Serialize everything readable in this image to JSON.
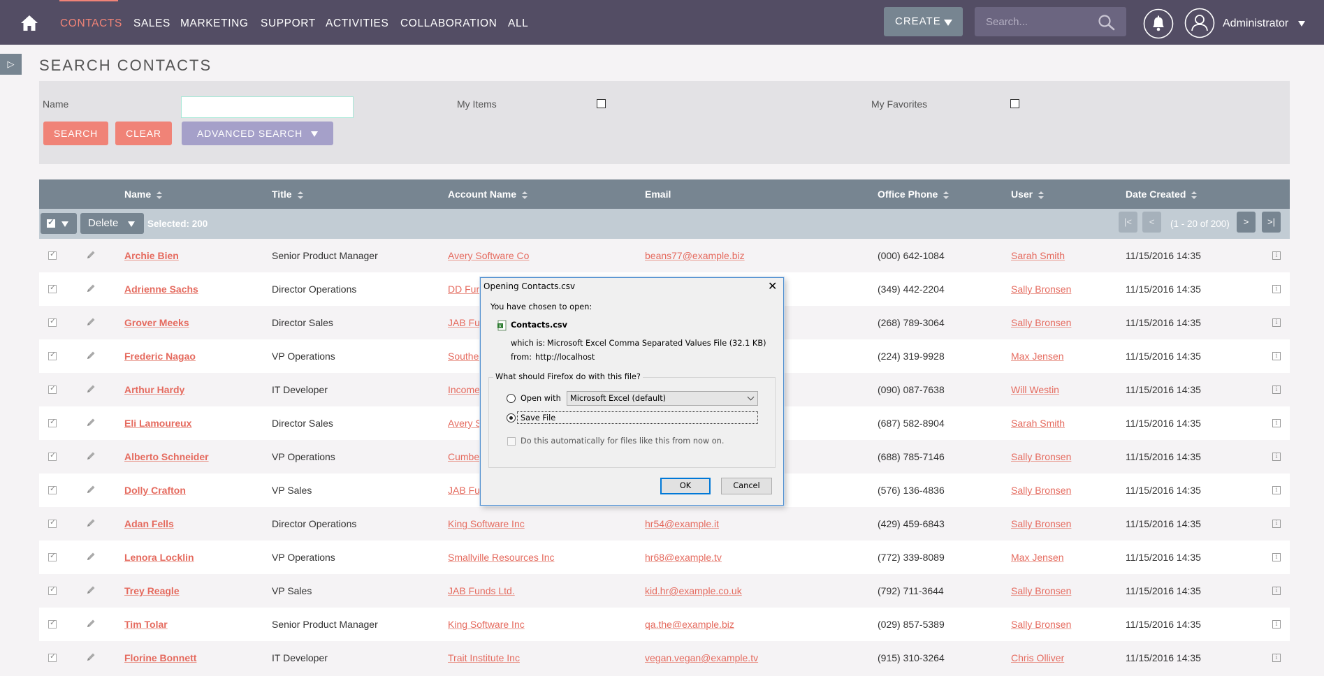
{
  "nav": {
    "items": [
      "CONTACTS",
      "SALES",
      "MARKETING",
      "SUPPORT",
      "ACTIVITIES",
      "COLLABORATION",
      "ALL"
    ],
    "create_label": "CREATE",
    "search_placeholder": "Search...",
    "user_name": "Administrator"
  },
  "page_title": "SEARCH CONTACTS",
  "search_form": {
    "name_label": "Name",
    "my_items_label": "My Items",
    "my_favorites_label": "My Favorites",
    "search_btn": "SEARCH",
    "clear_btn": "CLEAR",
    "advanced_btn": "ADVANCED SEARCH"
  },
  "table": {
    "columns": [
      "Name",
      "Title",
      "Account Name",
      "Email",
      "Office Phone",
      "User",
      "Date Created"
    ],
    "delete_label": "Delete",
    "selected_text": "Selected: 200",
    "pagination_text": "(1 - 20 of 200)",
    "rows": [
      {
        "name": "Archie Bien",
        "title": "Senior Product Manager",
        "account": "Avery Software Co",
        "email": "beans77@example.biz",
        "phone": "(000) 642-1084",
        "user": "Sarah Smith",
        "date": "11/15/2016 14:35"
      },
      {
        "name": "Adrienne Sachs",
        "title": "Director Operations",
        "account": "DD Furn",
        "email": "",
        "phone": "(349) 442-2204",
        "user": "Sally Bronsen",
        "date": "11/15/2016 14:35"
      },
      {
        "name": "Grover Meeks",
        "title": "Director Sales",
        "account": "JAB Fun",
        "email": "",
        "phone": "(268) 789-3064",
        "user": "Sally Bronsen",
        "date": "11/15/2016 14:35"
      },
      {
        "name": "Frederic Nagao",
        "title": "VP Operations",
        "account": "Souther",
        "email": "",
        "phone": "(224) 319-9928",
        "user": "Max Jensen",
        "date": "11/15/2016 14:35"
      },
      {
        "name": "Arthur Hardy",
        "title": "IT Developer",
        "account": "Income",
        "email": "",
        "phone": "(090) 087-7638",
        "user": "Will Westin",
        "date": "11/15/2016 14:35"
      },
      {
        "name": "Eli Lamoureux",
        "title": "Director Sales",
        "account": "Avery So",
        "email": "",
        "phone": "(687) 582-8904",
        "user": "Sarah Smith",
        "date": "11/15/2016 14:35"
      },
      {
        "name": "Alberto Schneider",
        "title": "VP Operations",
        "account": "Cumber",
        "email": "",
        "phone": "(688) 785-7146",
        "user": "Sally Bronsen",
        "date": "11/15/2016 14:35"
      },
      {
        "name": "Dolly Crafton",
        "title": "VP Sales",
        "account": "JAB Fun",
        "email": "",
        "phone": "(576) 136-4836",
        "user": "Sally Bronsen",
        "date": "11/15/2016 14:35"
      },
      {
        "name": "Adan Fells",
        "title": "Director Operations",
        "account": "King Software Inc",
        "email": "hr54@example.it",
        "phone": "(429) 459-6843",
        "user": "Sally Bronsen",
        "date": "11/15/2016 14:35"
      },
      {
        "name": "Lenora Locklin",
        "title": "VP Operations",
        "account": "Smallville Resources Inc",
        "email": "hr68@example.tv",
        "phone": "(772) 339-8089",
        "user": "Max Jensen",
        "date": "11/15/2016 14:35"
      },
      {
        "name": "Trey Reagle",
        "title": "VP Sales",
        "account": "JAB Funds Ltd.",
        "email": "kid.hr@example.co.uk",
        "phone": "(792) 711-3644",
        "user": "Sally Bronsen",
        "date": "11/15/2016 14:35"
      },
      {
        "name": "Tim Tolar",
        "title": "Senior Product Manager",
        "account": "King Software Inc",
        "email": "qa.the@example.biz",
        "phone": "(029) 857-5389",
        "user": "Sally Bronsen",
        "date": "11/15/2016 14:35"
      },
      {
        "name": "Florine Bonnett",
        "title": "IT Developer",
        "account": "Trait Institute Inc",
        "email": "vegan.vegan@example.tv",
        "phone": "(915) 310-3264",
        "user": "Chris Olliver",
        "date": "11/15/2016 14:35"
      }
    ]
  },
  "dialog": {
    "title": "Opening Contacts.csv",
    "close_glyph": "✕",
    "intro": "You have chosen to open:",
    "filename": "Contacts.csv",
    "which_is_label": "which is:",
    "which_is_value": "Microsoft Excel Comma Separated Values File (32.1 KB)",
    "from_label": "from:",
    "from_value": "http://localhost",
    "question": "What should Firefox do with this file?",
    "open_with_label": "Open with",
    "open_with_value": "Microsoft Excel (default)",
    "save_file_label": "Save File",
    "auto_label": "Do this automatically for files like this from now on.",
    "ok_label": "OK",
    "cancel_label": "Cancel"
  }
}
